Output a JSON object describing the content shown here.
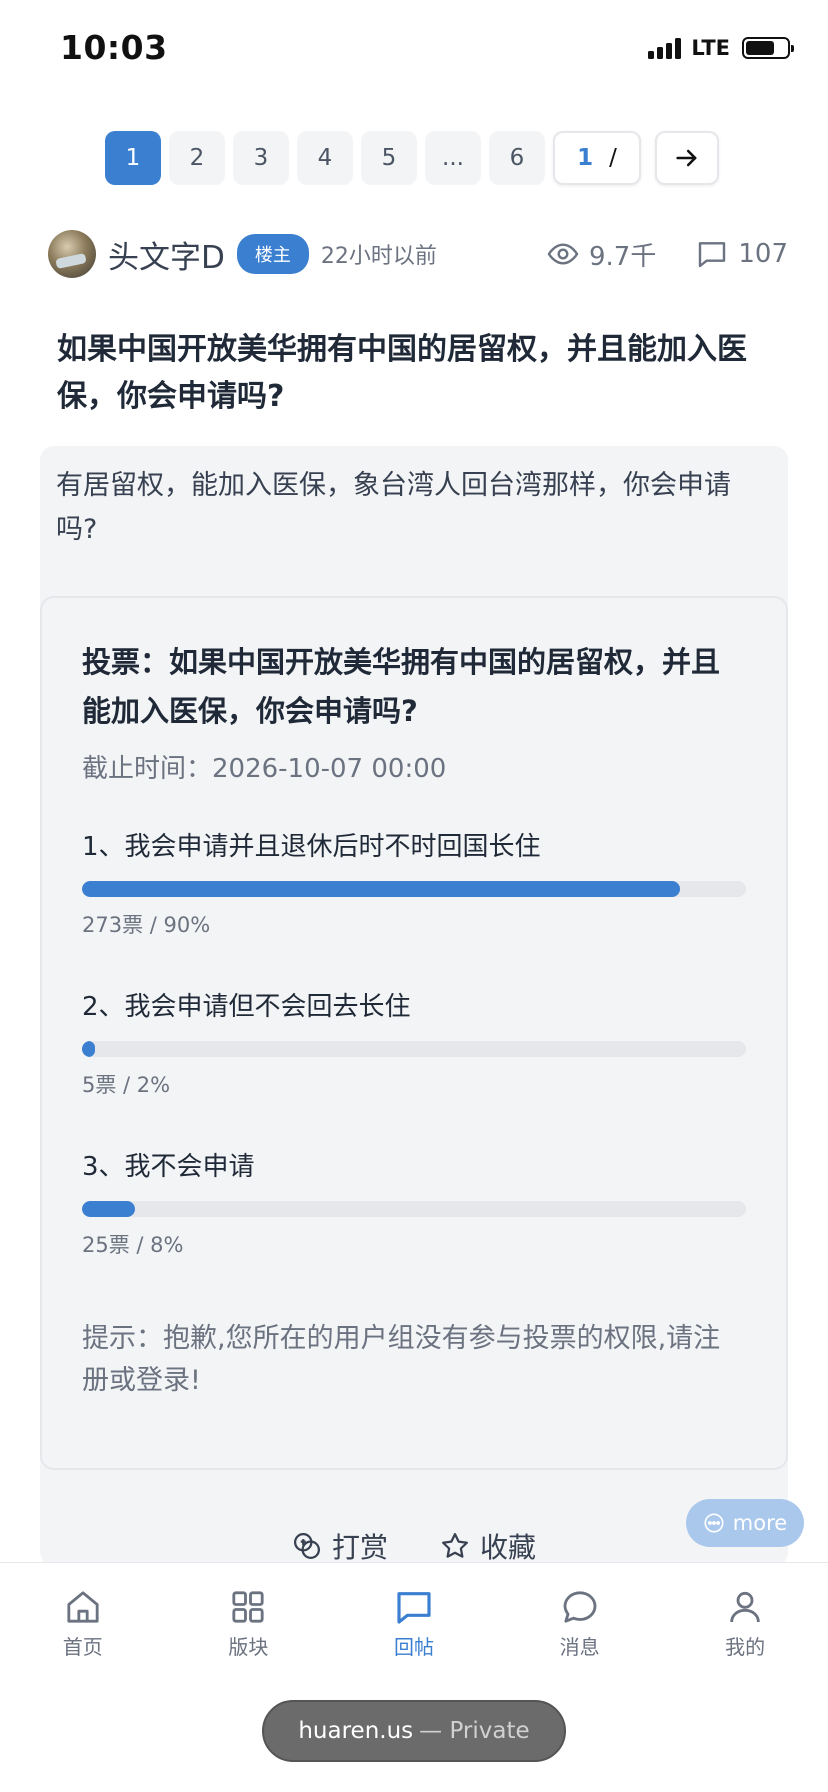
{
  "status_bar": {
    "time": "10:03",
    "network": "LTE"
  },
  "pagination": {
    "pages": [
      "1",
      "2",
      "3",
      "4",
      "5",
      "...",
      "6"
    ],
    "active_index": 0,
    "current_input": "1",
    "separator": "/"
  },
  "author": {
    "name": "头文字D",
    "badge": "楼主",
    "time": "22小时以前",
    "views": "9.7千",
    "replies": "107"
  },
  "post": {
    "title": "如果中国开放美华拥有中国的居留权，并且能加入医保，你会申请吗?",
    "body": "有居留权，能加入医保，象台湾人回台湾那样，你会申请吗?"
  },
  "poll": {
    "title": "投票：如果中国开放美华拥有中国的居留权，并且能加入医保，你会申请吗?",
    "deadline": "截止时间：2026-10-07 00:00",
    "options": [
      {
        "label": "1、我会申请并且退休后时不时回国长住",
        "result": "273票 / 90%",
        "percent": 90
      },
      {
        "label": "2、我会申请但不会回去长住",
        "result": "5票 / 2%",
        "percent": 2
      },
      {
        "label": "3、我不会申请",
        "result": "25票 / 8%",
        "percent": 8
      }
    ],
    "hint": "提示：抱歉,您所在的用户组没有参与投票的权限,请注册或登录!"
  },
  "actions": {
    "reward": "打赏",
    "favorite": "收藏"
  },
  "more": "more",
  "tabs": [
    {
      "label": "首页",
      "icon": "home-icon"
    },
    {
      "label": "版块",
      "icon": "grid-icon"
    },
    {
      "label": "回帖",
      "icon": "reply-icon",
      "active": true
    },
    {
      "label": "消息",
      "icon": "message-icon"
    },
    {
      "label": "我的",
      "icon": "user-icon"
    }
  ],
  "browser": {
    "domain": "huaren.us",
    "mode": "— Private"
  },
  "colors": {
    "accent": "#3b7fd1",
    "card_bg": "#f3f4f6",
    "track": "#e5e7eb"
  }
}
